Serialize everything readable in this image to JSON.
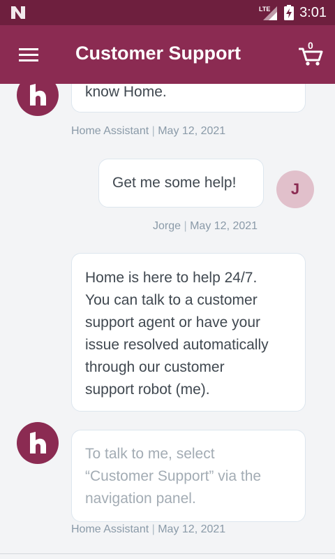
{
  "status_bar": {
    "network": "LTE",
    "time": "3:01"
  },
  "app_bar": {
    "title": "Customer Support",
    "cart_count": "0",
    "brand_color": "#8b2b52"
  },
  "messages": [
    {
      "sender": "Home Assistant",
      "text": "know Home.",
      "date": "May 12, 2021"
    },
    {
      "sender": "Jorge",
      "avatar_initial": "J",
      "text": "Get me some help!",
      "date": "May 12, 2021"
    },
    {
      "sender": "Home Assistant",
      "text_lines": [
        "Home is here to help 24/7.",
        "You can talk to a customer",
        "support agent or have your",
        "issue resolved automatically",
        "through our customer",
        "support robot (me)."
      ]
    },
    {
      "sender": "Home Assistant",
      "text_lines": [
        "To talk to me, select",
        "“Customer Support” via the",
        "navigation panel."
      ],
      "date": "May 12, 2021"
    }
  ],
  "meta_separator": "|"
}
